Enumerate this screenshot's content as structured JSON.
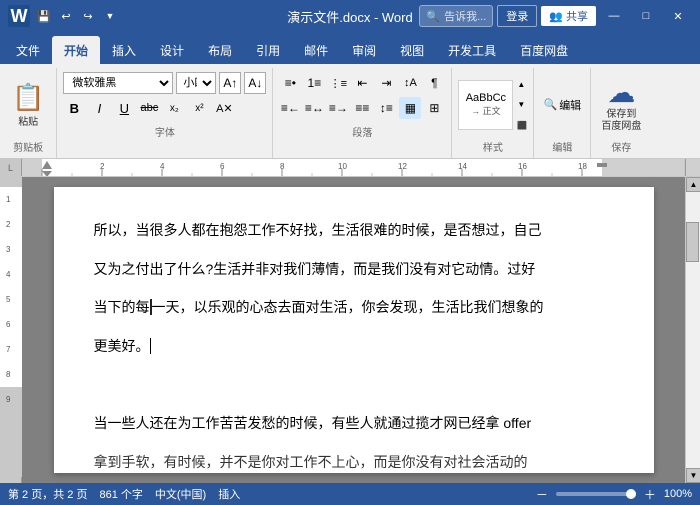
{
  "titleBar": {
    "title": "演示文件.docx - Word",
    "appName": "Word",
    "winBtns": [
      "—",
      "□",
      "×"
    ]
  },
  "quickAccess": {
    "save": "💾",
    "undo": "↩",
    "redo": "↪"
  },
  "ribbonTabs": {
    "tabs": [
      "文件",
      "开始",
      "插入",
      "设计",
      "布局",
      "引用",
      "邮件",
      "审阅",
      "视图",
      "开发工具",
      "百度网盘"
    ],
    "activeTab": "开始"
  },
  "ribbon": {
    "clipboard": {
      "label": "剪贴板",
      "paste": "粘贴"
    },
    "font": {
      "label": "字体",
      "name": "微软雅黑",
      "size": "小四",
      "boldLabel": "B",
      "italicLabel": "I",
      "underlineLabel": "U",
      "strikeLabel": "abc",
      "subLabel": "x₂",
      "supLabel": "x²",
      "clearLabel": "清"
    },
    "paragraph": {
      "label": "段落"
    },
    "styles": {
      "label": "样式",
      "normalText": "正文"
    },
    "editing": {
      "label": "编辑"
    },
    "save": {
      "label": "保存",
      "saveCloud": "保存到\n百度网盘"
    }
  },
  "tellMe": {
    "placeholder": "告诉我...",
    "icon": "🔍"
  },
  "userArea": {
    "login": "登录",
    "share": "共享"
  },
  "document": {
    "paragraphs": [
      "所以，当很多人都在抱怨工作不好找，生活很难的时候，是否想过，自己",
      "又为之付出了什么?生活并非对我们薄情，而是我们没有对它动情。过好",
      "当下的每一天，以乐观的心态去面对生活，你会发现，生活比我们想象的",
      "更美好。|",
      "",
      "当一些人还在为工作苦苦发愁的时候，有些人就通过揽才网已经拿 offer",
      "拿到手软，有时候，并不是你对工作不上心，而是你没有对社会活动的"
    ]
  },
  "statusBar": {
    "pageInfo": "第 2 页，共 2 页",
    "wordCount": "861 个字",
    "language": "中文(中国)",
    "insertMode": "插入",
    "zoom": "100%"
  }
}
